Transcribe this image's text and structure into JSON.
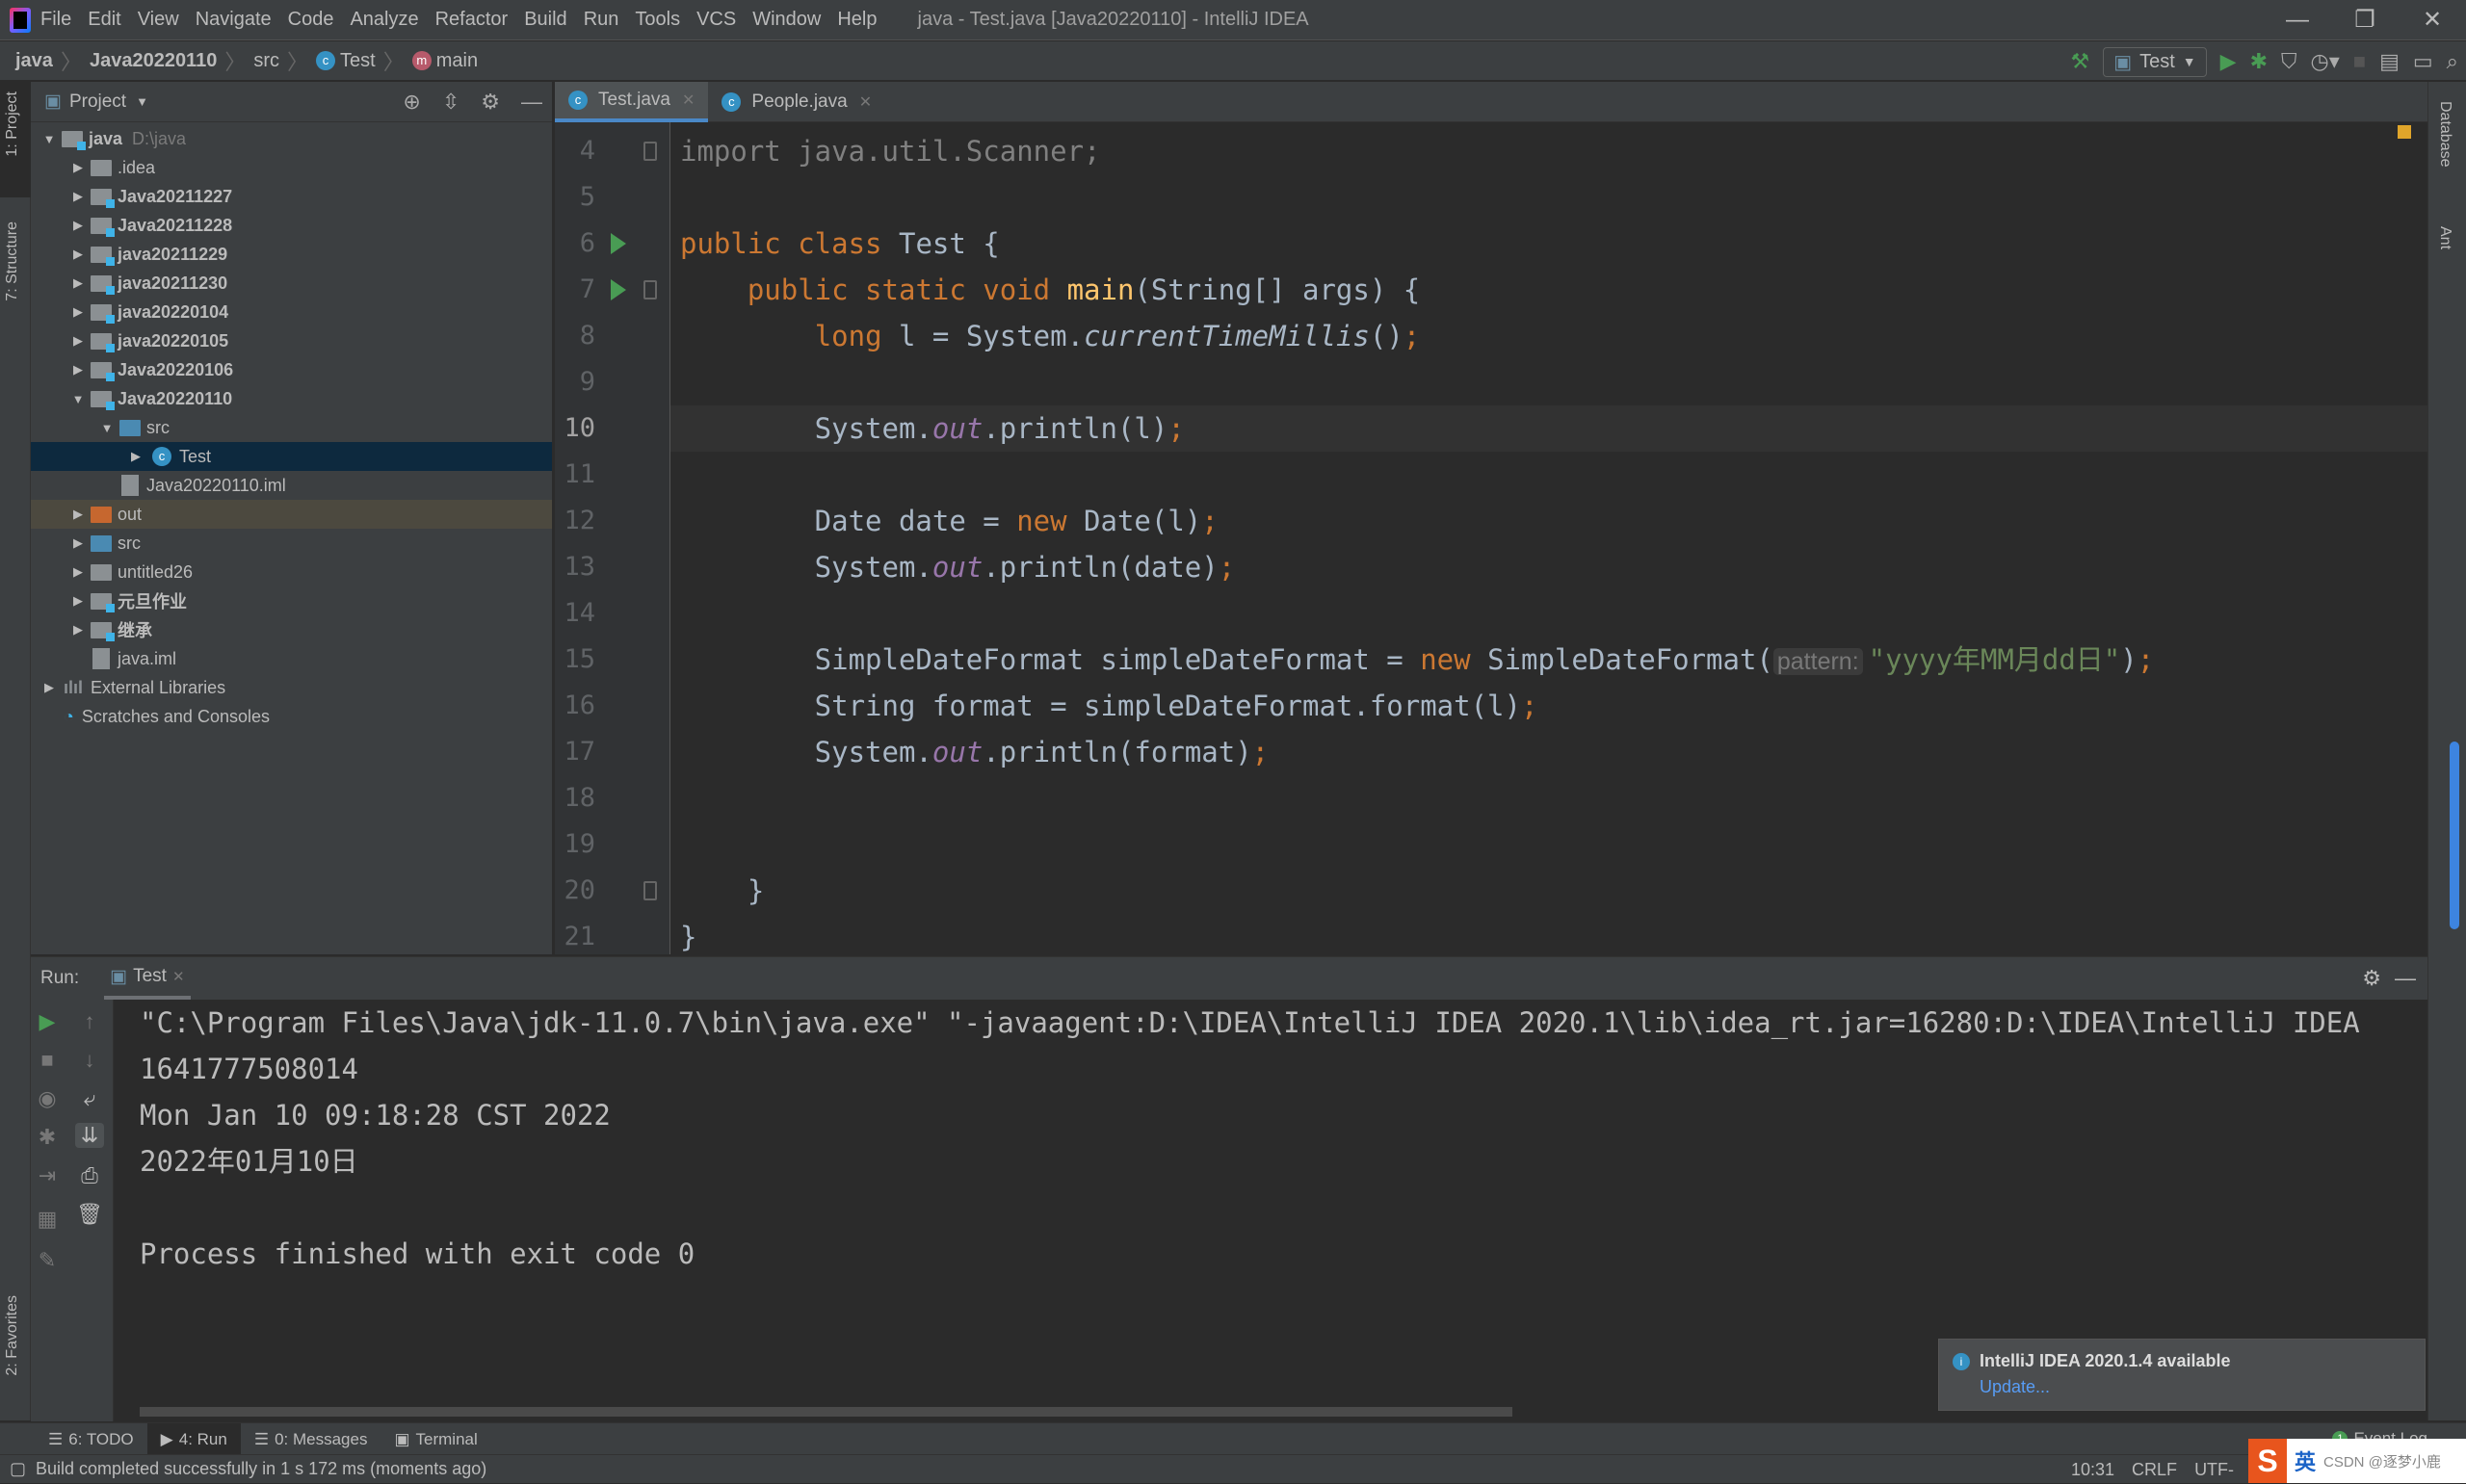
{
  "window": {
    "title": "java - Test.java [Java20220110] - IntelliJ IDEA",
    "controls": [
      "—",
      "❐",
      "✕"
    ]
  },
  "menu": [
    "File",
    "Edit",
    "View",
    "Navigate",
    "Code",
    "Analyze",
    "Refactor",
    "Build",
    "Run",
    "Tools",
    "VCS",
    "Window",
    "Help"
  ],
  "breadcrumb": [
    "java",
    "Java20220110",
    "src",
    "Test",
    "main"
  ],
  "toolbar": {
    "run_config": "Test"
  },
  "left_strip": {
    "project": "1: Project",
    "structure": "7: Structure",
    "favorites": "2: Favorites"
  },
  "right_strip": {
    "database": "Database",
    "ant": "Ant"
  },
  "project": {
    "header": "Project",
    "tree": [
      {
        "label": "java",
        "suffix": "D:\\java",
        "depth": 0,
        "arrow": "down",
        "icon": "module",
        "bold": true
      },
      {
        "label": ".idea",
        "depth": 1,
        "arrow": "right",
        "icon": "folder"
      },
      {
        "label": "Java20211227",
        "depth": 1,
        "arrow": "right",
        "icon": "module",
        "bold": true
      },
      {
        "label": "Java20211228",
        "depth": 1,
        "arrow": "right",
        "icon": "module",
        "bold": true
      },
      {
        "label": "java20211229",
        "depth": 1,
        "arrow": "right",
        "icon": "module",
        "bold": true
      },
      {
        "label": "java20211230",
        "depth": 1,
        "arrow": "right",
        "icon": "module",
        "bold": true
      },
      {
        "label": "java20220104",
        "depth": 1,
        "arrow": "right",
        "icon": "module",
        "bold": true
      },
      {
        "label": "java20220105",
        "depth": 1,
        "arrow": "right",
        "icon": "module",
        "bold": true
      },
      {
        "label": "Java20220106",
        "depth": 1,
        "arrow": "right",
        "icon": "module",
        "bold": true
      },
      {
        "label": "Java20220110",
        "depth": 1,
        "arrow": "down",
        "icon": "module",
        "bold": true
      },
      {
        "label": "src",
        "depth": 2,
        "arrow": "down",
        "icon": "src"
      },
      {
        "label": "Test",
        "depth": 3,
        "arrow": "right",
        "icon": "class",
        "selected": true
      },
      {
        "label": "Java20220110.iml",
        "depth": 2,
        "arrow": "",
        "icon": "file"
      },
      {
        "label": "out",
        "depth": 1,
        "arrow": "right",
        "icon": "out",
        "excluded": true
      },
      {
        "label": "src",
        "depth": 1,
        "arrow": "right",
        "icon": "src"
      },
      {
        "label": "untitled26",
        "depth": 1,
        "arrow": "right",
        "icon": "folder"
      },
      {
        "label": "元旦作业",
        "depth": 1,
        "arrow": "right",
        "icon": "module",
        "bold": true
      },
      {
        "label": "继承",
        "depth": 1,
        "arrow": "right",
        "icon": "module",
        "bold": true
      },
      {
        "label": "java.iml",
        "depth": 1,
        "arrow": "",
        "icon": "file"
      },
      {
        "label": "External Libraries",
        "depth": 0,
        "arrow": "right",
        "icon": "libs"
      },
      {
        "label": "Scratches and Consoles",
        "depth": 0,
        "arrow": "",
        "icon": "scratch"
      }
    ]
  },
  "editor": {
    "tabs": [
      {
        "label": "Test.java",
        "active": true
      },
      {
        "label": "People.java",
        "active": false
      }
    ],
    "current_line": 10,
    "lines": [
      {
        "n": 4,
        "tokens": [
          [
            "import java.util.Scanner;",
            "cm"
          ]
        ]
      },
      {
        "n": 5,
        "tokens": []
      },
      {
        "n": 6,
        "run": true,
        "tokens": [
          [
            "public class ",
            "kw"
          ],
          [
            "Test {",
            ""
          ]
        ]
      },
      {
        "n": 7,
        "run": true,
        "tokens": [
          [
            "    ",
            ""
          ],
          [
            "public static void ",
            "kw"
          ],
          [
            "main",
            "fn"
          ],
          [
            "(String[] args) {",
            ""
          ]
        ]
      },
      {
        "n": 8,
        "tokens": [
          [
            "        ",
            ""
          ],
          [
            "long ",
            "kw"
          ],
          [
            "l = System.",
            ""
          ],
          [
            "currentTimeMillis",
            "it"
          ],
          [
            "()",
            ""
          ],
          [
            ";",
            "sc"
          ]
        ]
      },
      {
        "n": 9,
        "tokens": []
      },
      {
        "n": 10,
        "tokens": [
          [
            "        System.",
            ""
          ],
          [
            "out",
            "fld"
          ],
          [
            ".println(l)",
            ""
          ],
          [
            ";",
            "sc"
          ]
        ]
      },
      {
        "n": 11,
        "tokens": []
      },
      {
        "n": 12,
        "tokens": [
          [
            "        Date date = ",
            ""
          ],
          [
            "new ",
            "kw"
          ],
          [
            "Date(l)",
            ""
          ],
          [
            ";",
            "sc"
          ]
        ]
      },
      {
        "n": 13,
        "tokens": [
          [
            "        System.",
            ""
          ],
          [
            "out",
            "fld"
          ],
          [
            ".println(date)",
            ""
          ],
          [
            ";",
            "sc"
          ]
        ]
      },
      {
        "n": 14,
        "tokens": []
      },
      {
        "n": 15,
        "tokens": [
          [
            "        SimpleDateFormat simpleDateFormat = ",
            ""
          ],
          [
            "new ",
            "kw"
          ],
          [
            "SimpleDateFormat(",
            ""
          ],
          [
            "pattern:",
            "hint"
          ],
          [
            "\"yyyy年MM月dd日\"",
            "st"
          ],
          [
            ")",
            ""
          ],
          [
            ";",
            "sc"
          ]
        ]
      },
      {
        "n": 16,
        "tokens": [
          [
            "        String format = simpleDateFormat.format(l)",
            ""
          ],
          [
            ";",
            "sc"
          ]
        ]
      },
      {
        "n": 17,
        "tokens": [
          [
            "        System.",
            ""
          ],
          [
            "out",
            "fld"
          ],
          [
            ".println(format)",
            ""
          ],
          [
            ";",
            "sc"
          ]
        ]
      },
      {
        "n": 18,
        "tokens": []
      },
      {
        "n": 19,
        "tokens": []
      },
      {
        "n": 20,
        "tokens": [
          [
            "    }",
            ""
          ]
        ]
      },
      {
        "n": 21,
        "tokens": [
          [
            "}",
            ""
          ]
        ]
      }
    ]
  },
  "run": {
    "label": "Run:",
    "tab": "Test",
    "output": [
      "\"C:\\Program Files\\Java\\jdk-11.0.7\\bin\\java.exe\" \"-javaagent:D:\\IDEA\\IntelliJ IDEA 2020.1\\lib\\idea_rt.jar=16280:D:\\IDEA\\IntelliJ IDEA",
      "1641777508014",
      "Mon Jan 10 09:18:28 CST 2022",
      "2022年01月10日",
      "",
      "Process finished with exit code 0"
    ]
  },
  "notification": {
    "title": "IntelliJ IDEA 2020.1.4 available",
    "link": "Update..."
  },
  "bottom_tabs": [
    {
      "label": "6: TODO",
      "icon": "☰"
    },
    {
      "label": "4: Run",
      "icon": "▶",
      "active": true
    },
    {
      "label": "0: Messages",
      "icon": "☰"
    },
    {
      "label": "Terminal",
      "icon": "▣"
    }
  ],
  "event_log": "Event Log",
  "status": {
    "message": "Build completed successfully in 1 s 172 ms (moments ago)",
    "position": "10:31",
    "line_sep": "CRLF",
    "encoding": "UTF-"
  },
  "ime": {
    "mode": "英",
    "text": "CSDN @逐梦小鹿"
  }
}
